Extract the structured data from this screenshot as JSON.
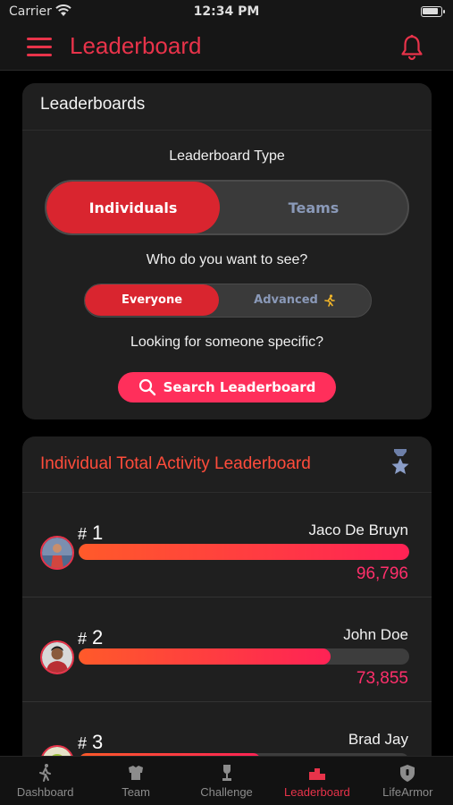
{
  "status_bar": {
    "carrier": "Carrier",
    "time": "12:34 PM"
  },
  "nav": {
    "title": "Leaderboard"
  },
  "filters_card": {
    "title": "Leaderboards",
    "type_label": "Leaderboard Type",
    "type_options": [
      "Individuals",
      "Teams"
    ],
    "type_selected": "Individuals",
    "who_label": "Who do you want to see?",
    "who_options": [
      "Everyone",
      "Advanced"
    ],
    "who_selected": "Everyone",
    "looking_label": "Looking for someone specific?",
    "search_button": "Search Leaderboard"
  },
  "leaderboard": {
    "title": "Individual Total Activity Leaderboard",
    "entries": [
      {
        "rank_prefix": "#",
        "rank": "1",
        "name": "Jaco De Bruyn",
        "score": "96,796",
        "progress": 1.0
      },
      {
        "rank_prefix": "#",
        "rank": "2",
        "name": "John Doe",
        "score": "73,855",
        "progress": 0.763
      },
      {
        "rank_prefix": "#",
        "rank": "3",
        "name": "Brad Jay",
        "score": "",
        "progress": 0.55
      }
    ]
  },
  "tabs": [
    {
      "label": "Dashboard",
      "icon": "walker-icon",
      "active": false
    },
    {
      "label": "Team",
      "icon": "team-icon",
      "active": false
    },
    {
      "label": "Challenge",
      "icon": "trophy-icon",
      "active": false
    },
    {
      "label": "Leaderboard",
      "icon": "podium-icon",
      "active": true
    },
    {
      "label": "LifeArmor",
      "icon": "shield-icon",
      "active": false
    }
  ],
  "colors": {
    "accent": "#e8334a",
    "active_segment": "#d9252f",
    "score": "#ff2f6b",
    "title_orange": "#ff4c3b"
  }
}
